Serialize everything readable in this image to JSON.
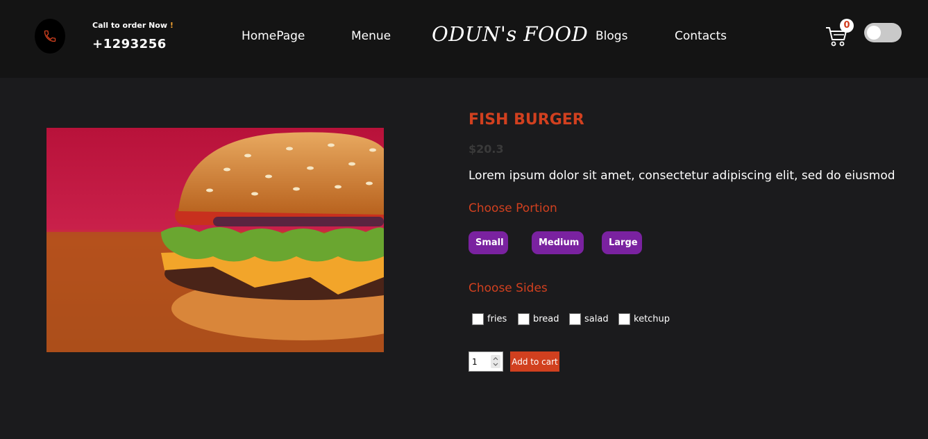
{
  "header": {
    "call_label": "Call to order Now",
    "call_excl": "!",
    "phone": "+1293256",
    "nav": [
      {
        "label": "HomePage"
      },
      {
        "label": "Menue"
      },
      {
        "label": "Blogs"
      },
      {
        "label": "Contacts"
      }
    ],
    "logo": "ODUN's FOOD",
    "cart_count": "0",
    "theme_toggle_on": false
  },
  "product": {
    "image_alt": "Burger",
    "title": "FISH BURGER",
    "price": "$20.3",
    "description": "Lorem ipsum dolor sit amet, consectetur adipiscing elit, sed do eiusmod",
    "portion_label": "Choose Portion",
    "portions": [
      {
        "label": "Small"
      },
      {
        "label": "Medium"
      },
      {
        "label": "Large"
      }
    ],
    "sides_label": "Choose Sides",
    "sides": [
      {
        "label": "fries"
      },
      {
        "label": "bread"
      },
      {
        "label": "salad"
      },
      {
        "label": "ketchup"
      }
    ],
    "quantity": "1",
    "add_to_cart": "Add to cart"
  },
  "colors": {
    "accent": "#d1401f",
    "portion_button": "#7a22a0",
    "background": "#1b1b1d",
    "header_bg": "#141414"
  }
}
